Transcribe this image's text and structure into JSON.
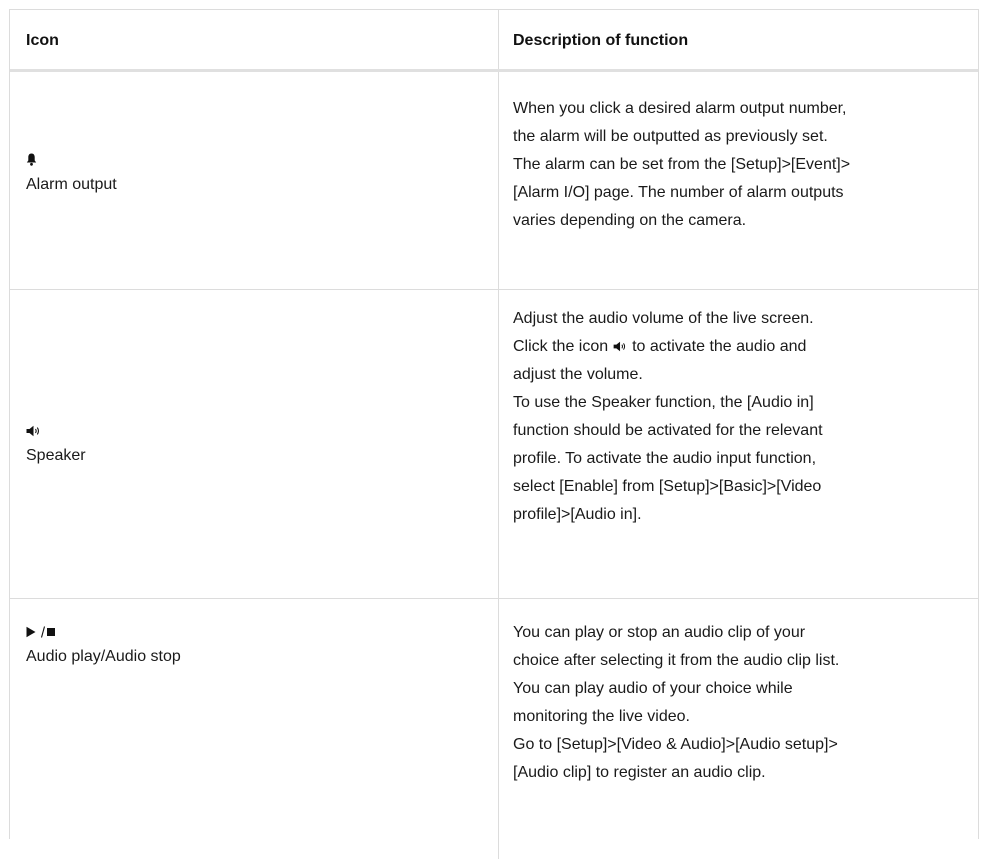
{
  "header": {
    "icon_col": "Icon",
    "desc_col": "Description of function"
  },
  "rows": [
    {
      "icon": "bell-icon",
      "glyph": "🔔",
      "name": "Alarm output",
      "lines": [
        "When you click a desired alarm output number,",
        "the alarm will be outputted as previously set.",
        "The alarm can be set from the [Setup]>[Event]>",
        "[Alarm I/O] page. The number of alarm outputs",
        "varies depending on the camera."
      ]
    },
    {
      "icon": "speaker-icon",
      "glyph": "🔊",
      "name": "Speaker",
      "lines": [
        "Adjust the audio volume of the live screen.",
        "Click the icon",
        "to activate the audio and",
        "adjust the volume.",
        "To use the Speaker function, the [Audio in]",
        "function should be activated for the relevant",
        "profile. To activate the audio input function,",
        "select [Enable] from [Setup]>[Basic]>[Video",
        "profile]>[Audio in]."
      ]
    },
    {
      "icon": "play-stop-icon",
      "glyph": "▶ / ■",
      "name": "Audio play/Audio stop",
      "lines": [
        "You can play or stop an audio clip of your",
        "choice after selecting it from the audio clip list.",
        "You can play audio of your choice while",
        "monitoring the live video.",
        "Go to [Setup]>[Video & Audio]>[Audio setup]>",
        "[Audio clip] to register an audio clip."
      ]
    }
  ]
}
